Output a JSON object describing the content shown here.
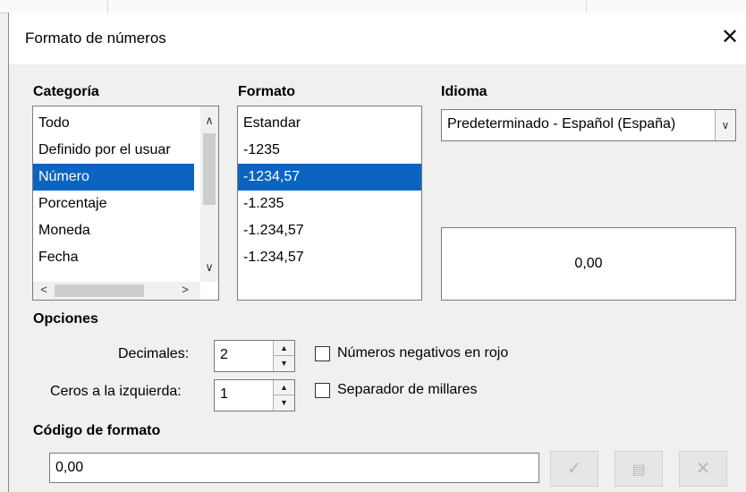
{
  "dialog": {
    "title": "Formato de números"
  },
  "category": {
    "label": "Categoría",
    "items": [
      "Todo",
      "Definido por el usuar",
      "Número",
      "Porcentaje",
      "Moneda",
      "Fecha"
    ],
    "selected": "Número"
  },
  "format": {
    "label": "Formato",
    "items": [
      "Estandar",
      "-1235",
      "-1234,57",
      "-1.235",
      "-1.234,57",
      "-1.234,57"
    ],
    "selected": "-1234,57"
  },
  "language": {
    "label": "Idioma",
    "value": "Predeterminado - Español (España)"
  },
  "preview": {
    "value": "0,00"
  },
  "options": {
    "label": "Opciones",
    "decimals_label": "Decimales:",
    "decimals_value": "2",
    "leading_zeros_label": "Ceros a la izquierda:",
    "leading_zeros_value": "1",
    "negative_red_label": "Números negativos en rojo",
    "negative_red_checked": false,
    "thousands_sep_label": "Separador de millares",
    "thousands_sep_checked": false
  },
  "format_code": {
    "label": "Código de formato",
    "value": "0,00"
  },
  "icons": {
    "close": "close-icon",
    "accept": "checkmark-icon",
    "add_comment": "edit-comment-icon",
    "delete": "delete-icon"
  }
}
